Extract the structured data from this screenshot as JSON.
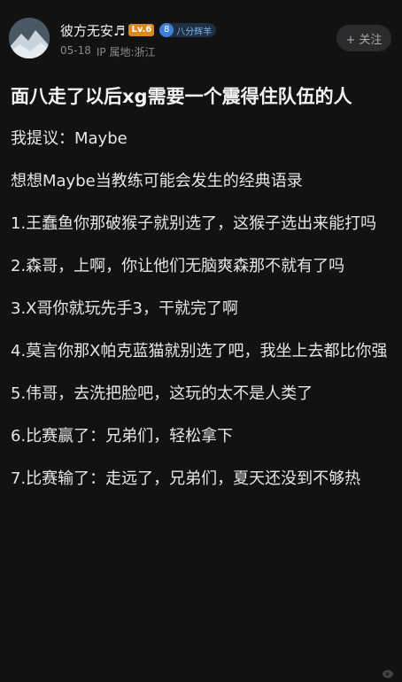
{
  "user": {
    "name": "彼方无安♬",
    "level": "Lv.6",
    "fan_badge_number": "8",
    "fan_badge_label": "八分辉羊",
    "date": "05-18",
    "ip_location": "IP 属地:浙江"
  },
  "follow_button": {
    "label": "+ 关注"
  },
  "post": {
    "title": "面八走了以后xg需要一个震得住队伍的人",
    "paragraphs": [
      "我提议：Maybe",
      "想想Maybe当教练可能会发生的经典语录",
      "1.王蠢鱼你那破猴子就别选了，这猴子选出来能打吗",
      "2.森哥，上啊，你让他们无脑爽森那不就有了吗",
      "3.X哥你就玩先手3，干就完了啊",
      "4.莫言你那X帕克蓝猫就别选了吧，我坐上去都比你强",
      "5.伟哥，去洗把脸吧，这玩的太不是人类了",
      "6.比赛赢了：兄弟们，轻松拿下",
      "7.比赛输了：走远了，兄弟们，夏天还没到不够热"
    ]
  }
}
